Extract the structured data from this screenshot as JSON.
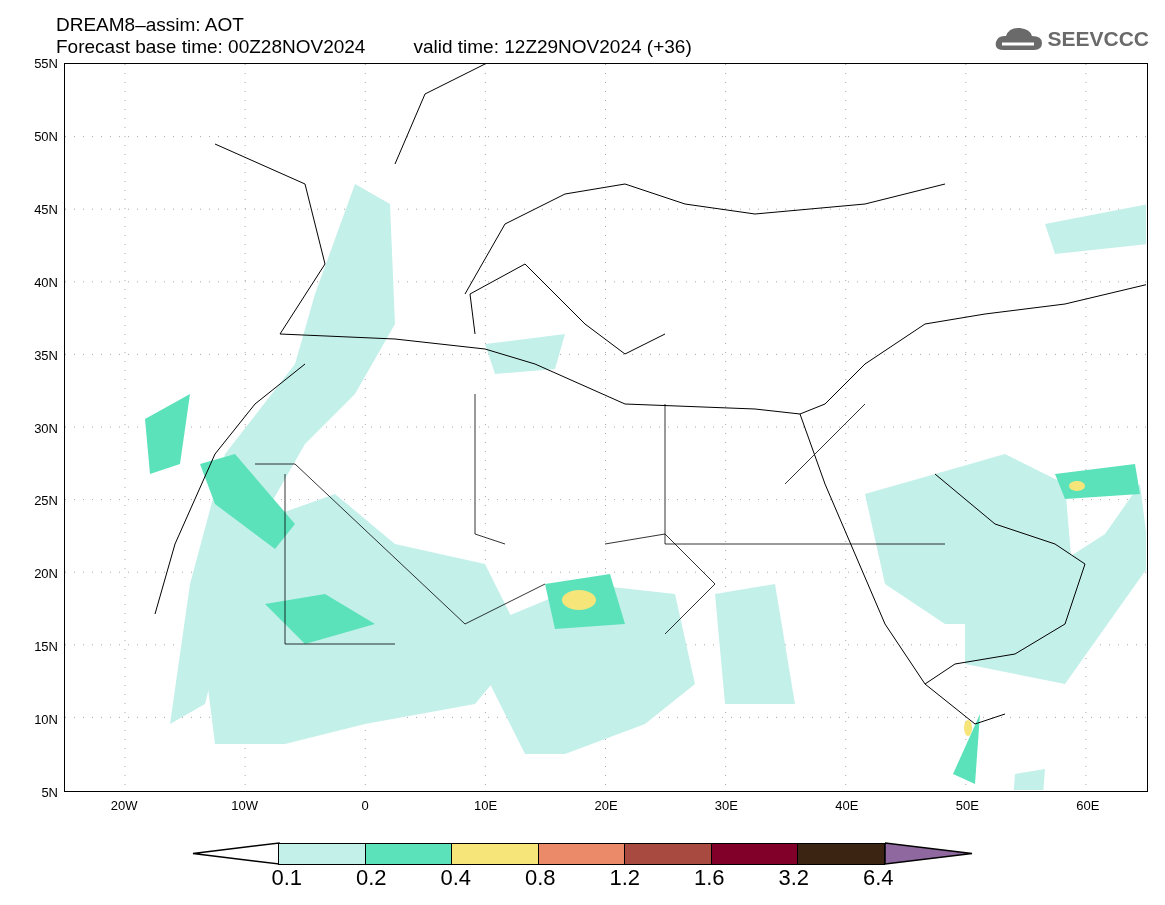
{
  "header": {
    "title": "DREAM8–assim: AOT",
    "base_time": "Forecast base time: 00Z28NOV2024",
    "valid_time": "valid time: 12Z29NOV2024 (+36)"
  },
  "logo": {
    "text": "SEEVCCC"
  },
  "map": {
    "lat_labels": [
      "55N",
      "50N",
      "45N",
      "40N",
      "35N",
      "30N",
      "25N",
      "20N",
      "15N",
      "10N",
      "5N"
    ],
    "lon_labels": [
      "20W",
      "10W",
      "0",
      "10E",
      "20E",
      "30E",
      "40E",
      "50E",
      "60E"
    ]
  },
  "colorbar": {
    "below": {
      "color": "#ffffff"
    },
    "above": {
      "color": "#9068a0"
    },
    "bins": [
      {
        "color": "#c4f0ea"
      },
      {
        "color": "#5ce2ba"
      },
      {
        "color": "#f6e67a"
      },
      {
        "color": "#ea8a68"
      },
      {
        "color": "#a84a40"
      },
      {
        "color": "#80002a"
      },
      {
        "color": "#3c2412"
      }
    ],
    "labels": [
      "0.1",
      "0.2",
      "0.4",
      "0.8",
      "1.2",
      "1.6",
      "3.2",
      "6.4"
    ]
  }
}
